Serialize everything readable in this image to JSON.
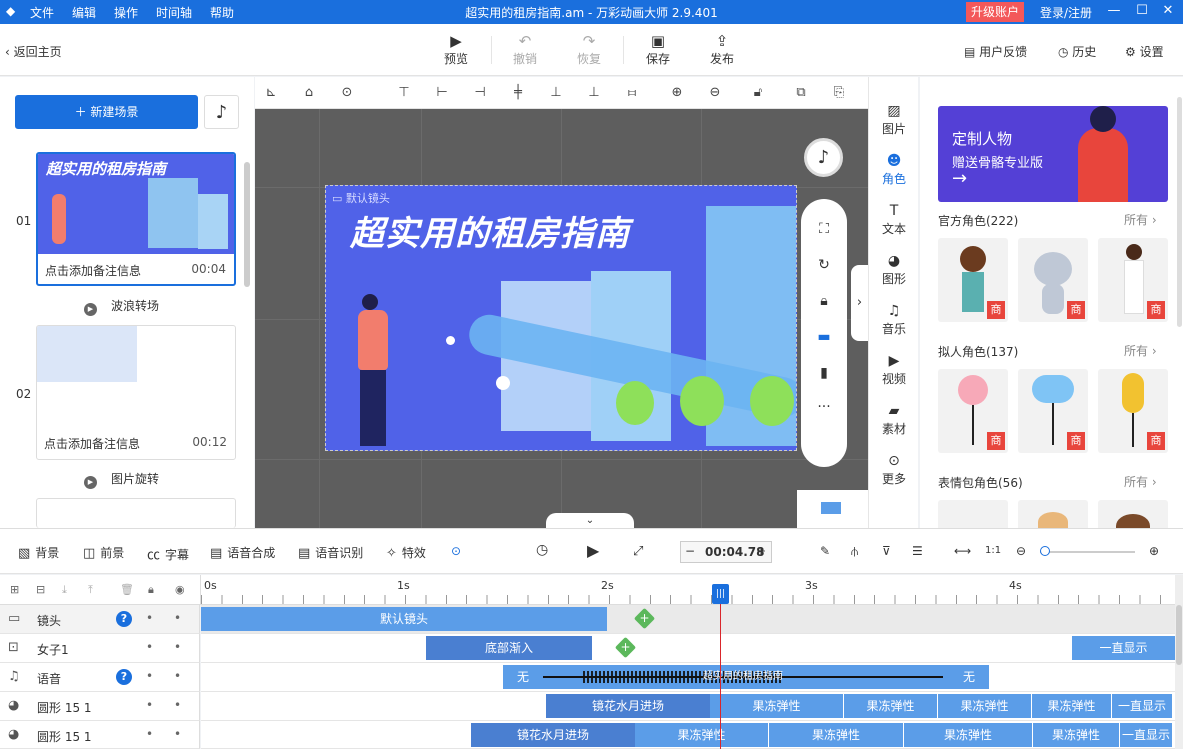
{
  "titlebar": {
    "menus": [
      "文件",
      "编辑",
      "操作",
      "时间轴",
      "帮助"
    ],
    "title": "超实用的租房指南.am - 万彩动画大师 2.9.401",
    "upgrade": "升级账户",
    "login": "登录/注册",
    "min": "—",
    "max": "☐",
    "close": "✕"
  },
  "toolbar": {
    "back": "返回主页",
    "preview": "预览",
    "undo": "撤销",
    "redo": "恢复",
    "save": "保存",
    "publish": "发布",
    "feedback": "用户反馈",
    "history": "历史",
    "settings": "设置"
  },
  "left": {
    "new_scene": "新建场景",
    "scenes": [
      {
        "num": "01",
        "title": "超实用的租房指南",
        "note": "点击添加备注信息",
        "duration": "00:04",
        "transition": "波浪转场"
      },
      {
        "num": "02",
        "note": "点击添加备注信息",
        "duration": "00:12",
        "transition": "图片旋转"
      }
    ]
  },
  "canvas": {
    "camera_label": "默认镜头",
    "stage_title": "超实用的租房指南"
  },
  "iconcol": [
    {
      "label": "图片",
      "icon": "image-icon"
    },
    {
      "label": "角色",
      "icon": "character-icon",
      "selected": true
    },
    {
      "label": "文本",
      "icon": "text-icon"
    },
    {
      "label": "图形",
      "icon": "shape-icon"
    },
    {
      "label": "音乐",
      "icon": "music-icon"
    },
    {
      "label": "视频",
      "icon": "video-icon"
    },
    {
      "label": "素材",
      "icon": "folder-icon"
    },
    {
      "label": "更多",
      "icon": "more-icon"
    }
  ],
  "assets": {
    "banner_title": "定制人物",
    "banner_sub": "赠送骨骼专业版",
    "banner_arrow": "→",
    "sections": [
      {
        "title": "官方角色(222)",
        "more": "所有 ›"
      },
      {
        "title": "拟人角色(137)",
        "more": "所有 ›"
      },
      {
        "title": "表情包角色(56)",
        "more": "所有 ›"
      }
    ],
    "badge": "商"
  },
  "timeline_toolbar": {
    "background": "背景",
    "foreground": "前景",
    "subtitle": "字幕",
    "tts": "语音合成",
    "asr": "语音识别",
    "effects": "特效",
    "time": "00:04.78",
    "minus": "−",
    "plus": "+"
  },
  "ruler": [
    "0s",
    "1s",
    "2s",
    "3s",
    "4s"
  ],
  "tracks": [
    {
      "name": "镜头",
      "clips": [
        "默认镜头"
      ]
    },
    {
      "name": "女子1",
      "clips": [
        "底部渐入",
        "一直显示"
      ]
    },
    {
      "name": "语音",
      "clips": [
        "无",
        "超实用的租房指南",
        "无"
      ]
    },
    {
      "name": "圆形 15 1",
      "clips": [
        "镜花水月进场",
        "果冻弹性",
        "果冻弹性",
        "果冻弹性",
        "果冻弹性",
        "一直显示"
      ]
    },
    {
      "name": "圆形 15 1",
      "clips": [
        "镜花水月进场",
        "果冻弹性",
        "果冻弹性",
        "果冻弹性",
        "果冻弹性",
        "一直显示"
      ]
    }
  ],
  "colors": {
    "accent": "#1a6fdd",
    "stage": "#5062e8",
    "clip": "#5b9de8",
    "badge": "#e8453c"
  }
}
